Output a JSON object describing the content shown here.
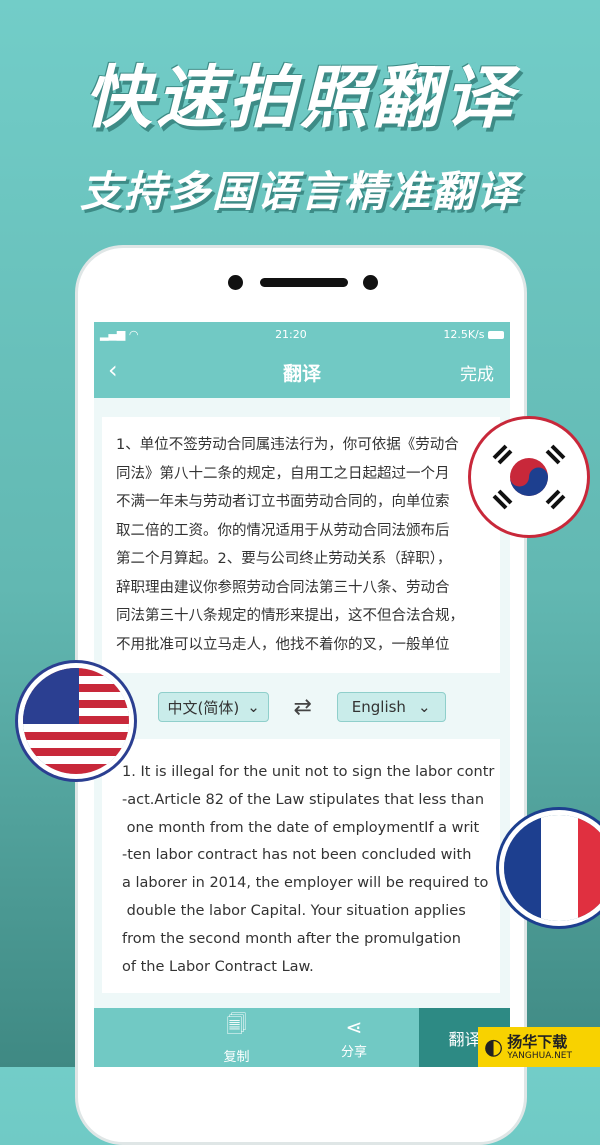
{
  "headline": "快速拍照翻译",
  "subheadline": "支持多国语言精准翻译",
  "status": {
    "time": "21:20",
    "speed": "12.5K/s"
  },
  "nav": {
    "back": "‹",
    "title": "翻译",
    "done": "完成"
  },
  "source_lines": [
    "1、单位不签劳动合同属违法行为，你可依据《劳动合",
    "同法》第八十二条的规定，自用工之日起超过一个月",
    "不满一年未与劳动者订立书面劳动合同的，向单位索",
    "取二倍的工资。你的情况适用于从劳动合同法颁布后",
    "第二个月算起。2、要与公司终止劳动关系（辞职），",
    "辞职理由建议你参照劳动合同法第三十八条、劳动合",
    "同法第三十八条规定的情形来提出，这不但合法合规，",
    "不用批准可以立马走人，他找不着你的叉，一般单位"
  ],
  "languages": {
    "from": "中文(简体)",
    "to": "English",
    "swap_icon": "swap-arrows"
  },
  "translation_lines": [
    "1. It is illegal for the unit not to sign the labor contr",
    "-act.Article 82 of the Law stipulates that less than",
    " one month from the date of employmentIf a writ",
    "-ten labor contract has not been concluded with",
    "a laborer in 2014, the employer will be required to",
    " double the labor Capital. Your situation applies",
    "from the second month after the promulgation",
    "of the Labor Contract Law."
  ],
  "toolbar": {
    "copy": "复制",
    "share": "分享",
    "translate": "翻译"
  },
  "watermark": {
    "name": "扬华下载",
    "url": "YANGHUA.NET"
  },
  "colors": {
    "accent": "#71c9c4",
    "active": "#2d8a84"
  }
}
